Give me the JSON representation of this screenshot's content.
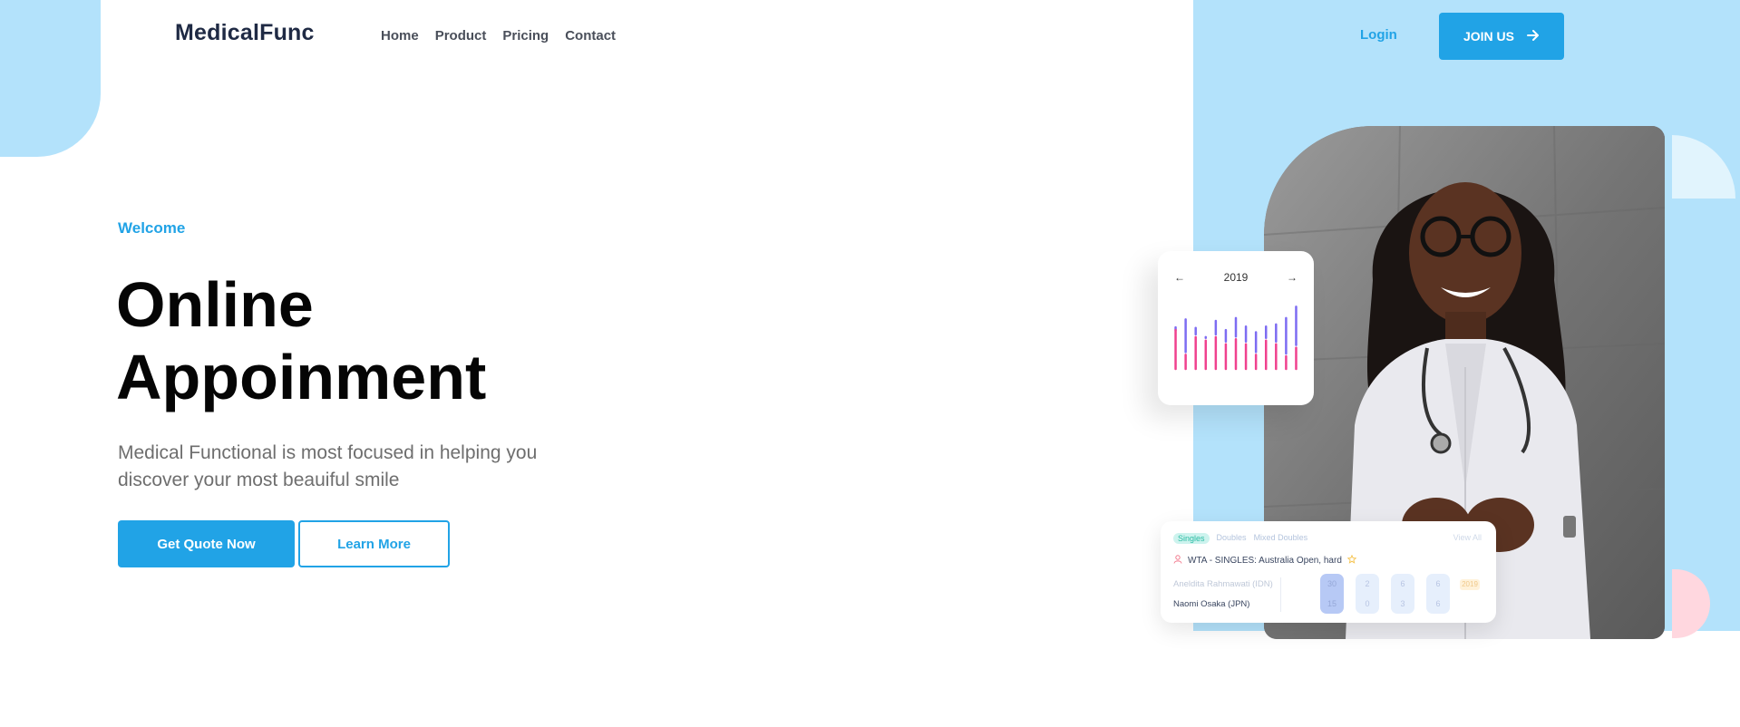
{
  "header": {
    "logo": "MedicalFunc",
    "nav": [
      "Home",
      "Product",
      "Pricing",
      "Contact"
    ],
    "login": "Login",
    "join": "JOIN US"
  },
  "hero": {
    "welcome": "Welcome",
    "title_line1": "Online",
    "title_line2": "Appoinment",
    "description_line1": "Medical Functional is most focused in helping you",
    "description_line2": "discover your most beauiful smile",
    "primary_button": "Get Quote Now",
    "secondary_button": "Learn More"
  },
  "chart_card": {
    "year": "2019",
    "prev_arrow": "←",
    "next_arrow": "→"
  },
  "chart_data": {
    "type": "bar",
    "series": [
      {
        "values": [
          0.55,
          0.7,
          0.58,
          0.45,
          0.68,
          0.55,
          0.72,
          0.6,
          0.52,
          0.6,
          0.63,
          0.72,
          0.88
        ]
      },
      {
        "values": [
          0.55,
          0.2,
          0.45,
          0.4,
          0.45,
          0.35,
          0.42,
          0.35,
          0.2,
          0.4,
          0.35,
          0.18,
          0.3
        ]
      }
    ],
    "colors": [
      "#7d6cf2",
      "#f0418e"
    ]
  },
  "match_card": {
    "tabs": [
      "Singles",
      "Doubles",
      "Mixed Doubles"
    ],
    "view_all": "View All",
    "event": "WTA - SINGLES: Australia Open, hard",
    "player1": "Aneldita Rahmawati (IDN)",
    "player2": "Naomi Osaka (JPN)",
    "scores": [
      [
        "30",
        "15"
      ],
      [
        "2",
        "0"
      ],
      [
        "6",
        "3"
      ],
      [
        "6",
        "6"
      ]
    ],
    "badge": "2019"
  },
  "colors": {
    "accent": "#21a3e6",
    "panel": "#b3e2fb",
    "heading": "#050505"
  }
}
